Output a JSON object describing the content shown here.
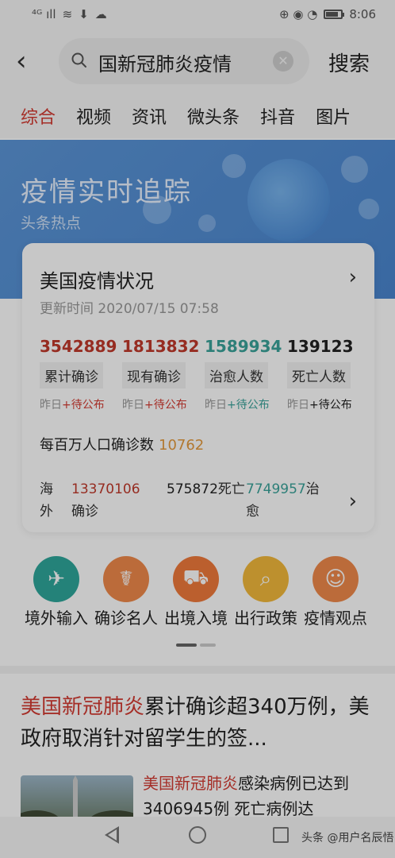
{
  "status_bar": {
    "time": "8:06",
    "signal": "⁴ᴳ ıll",
    "icons_right": "⊕ ◉ ◔"
  },
  "search": {
    "query": "国新冠肺炎疫情",
    "submit_label": "搜索"
  },
  "tabs": [
    "综合",
    "视频",
    "资讯",
    "微头条",
    "抖音",
    "图片"
  ],
  "banner": {
    "title": "疫情实时追踪",
    "subtitle": "头条热点"
  },
  "card": {
    "title": "美国疫情状况",
    "updated": "更新时间 2020/07/15 07:58",
    "stats": [
      {
        "value": "3542889",
        "label": "累计确诊",
        "sub_prefix": "昨日",
        "sub_plus": "+待公布",
        "color": "#c0392b"
      },
      {
        "value": "1813832",
        "label": "现有确诊",
        "sub_prefix": "昨日",
        "sub_plus": "+待公布",
        "color": "#c0392b"
      },
      {
        "value": "1589934",
        "label": "治愈人数",
        "sub_prefix": "昨日",
        "sub_plus": "+待公布",
        "color": "#3aa39a"
      },
      {
        "value": "139123",
        "label": "死亡人数",
        "sub_prefix": "昨日",
        "sub_plus": "+待公布",
        "color": "#222222"
      }
    ],
    "per_million_label": "每百万人口确诊数",
    "per_million_value": "10762",
    "overseas": {
      "label": "海外",
      "confirmed_num": "13370106",
      "confirmed_label": "确诊",
      "deaths_num": "575872",
      "deaths_label": "死亡",
      "recovered_num": "7749957",
      "recovered_label": "治愈"
    }
  },
  "quick_links": [
    {
      "label": "境外输入",
      "icon": "airplane-icon",
      "glyph": "✈",
      "color": "#2fa79b"
    },
    {
      "label": "确诊名人",
      "icon": "stethoscope-icon",
      "glyph": "☤",
      "color": "#f08a4b"
    },
    {
      "label": "出境入境",
      "icon": "car-icon",
      "glyph": "⛟",
      "color": "#f07a3c"
    },
    {
      "label": "出行政策",
      "icon": "search-icon",
      "glyph": "⌕",
      "color": "#f3b93b"
    },
    {
      "label": "疫情观点",
      "icon": "doctor-icon",
      "glyph": "☺",
      "color": "#f08a4b"
    }
  ],
  "article": {
    "title_highlight": "美国新冠肺炎",
    "title_rest": "累计确诊超340万例，美政府取消针对留学生的签..."
  },
  "article2": {
    "highlight": "美国新冠肺炎",
    "text_line1": "感染病例已达到",
    "text_line2": "3406945例 死亡病例达"
  },
  "watermark": "头条 @用户名辰悟"
}
